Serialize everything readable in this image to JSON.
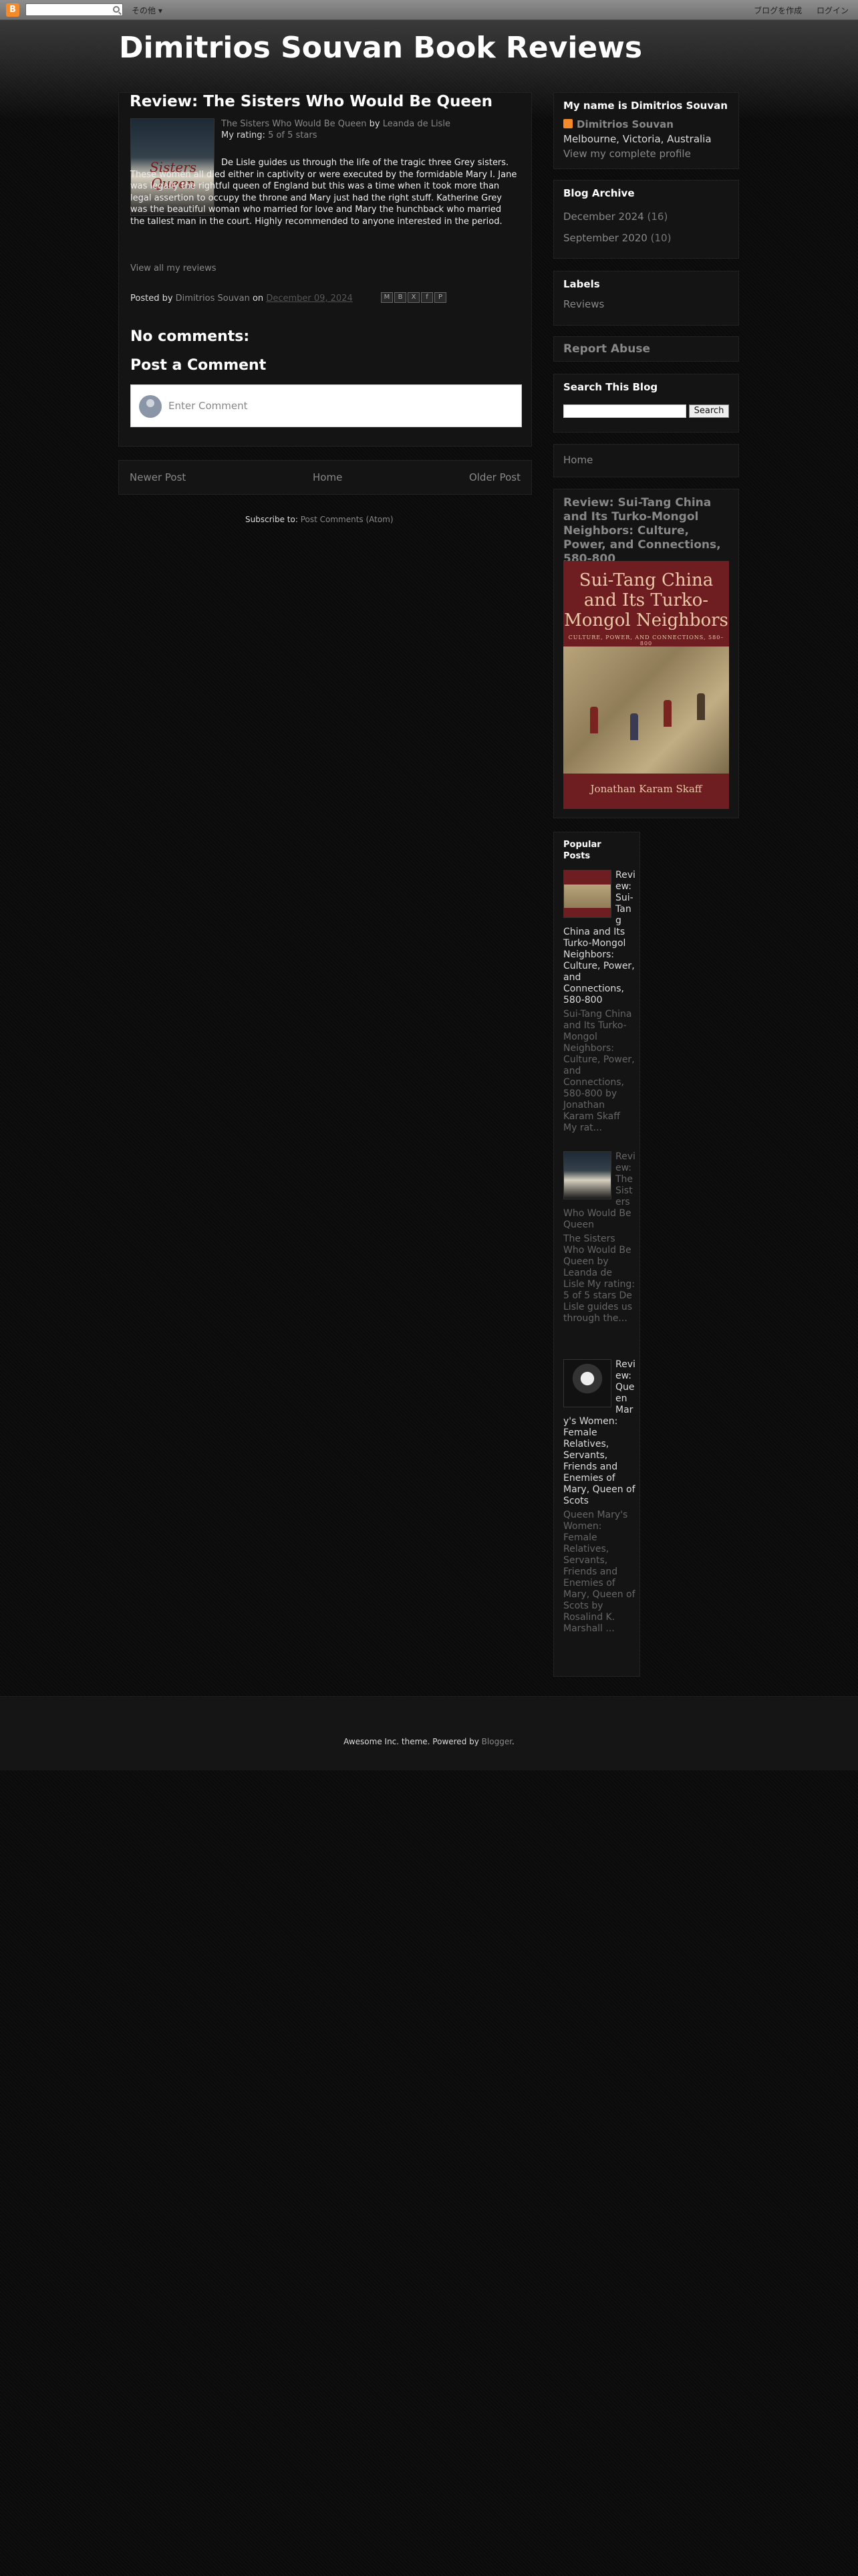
{
  "navbar": {
    "logo": "B",
    "more": "その他 ▾",
    "create_blog": "ブログを作成",
    "login": "ログイン"
  },
  "header": {
    "title": "Dimitrios Souvan Book Reviews"
  },
  "post": {
    "title": "Review: The Sisters Who Would Be Queen",
    "cover_title": "Sisters Queen",
    "book_link": "The Sisters Who Would Be Queen",
    "by": "by",
    "author_link": "Leanda de Lisle",
    "rating_label": "My rating:",
    "rating_value": "5 of 5 stars",
    "body": "De Lisle guides us through the life of the tragic three Grey sisters. These women all died either in captivity or were executed by the formidable Mary I. Jane was legally the rightful queen of England but this was a time when it took more than legal assertion to occupy the throne and Mary just had the right stuff. Katherine Grey was the beautiful woman who married for love and Mary the hunchback who married the tallest man in the court. Highly recommended to anyone interested in the period.",
    "view_all": "View all my reviews",
    "posted_by_label": "Posted by",
    "posted_by_author": "Dimitrios Souvan",
    "on": "on",
    "date": "December 09, 2024",
    "share_icons": [
      "mail-icon",
      "blog-icon",
      "x-icon",
      "facebook-icon",
      "pinterest-icon"
    ],
    "share_glyphs": [
      "M",
      "B",
      "X",
      "f",
      "P"
    ]
  },
  "comments": {
    "heading": "No comments:",
    "post_heading": "Post a Comment",
    "placeholder": "Enter Comment"
  },
  "pager": {
    "newer": "Newer Post",
    "home": "Home",
    "older": "Older Post"
  },
  "subscribe": {
    "label": "Subscribe to:",
    "link": "Post Comments (Atom)"
  },
  "sidebar": {
    "profile": {
      "heading": "My name is Dimitrios Souvan",
      "name": "Dimitrios Souvan",
      "location": "Melbourne, Victoria, Australia",
      "link": "View my complete profile"
    },
    "archive": {
      "heading": "Blog Archive",
      "items": [
        {
          "label": "December 2024",
          "count": "(16)"
        },
        {
          "label": "September 2020",
          "count": "(10)"
        }
      ]
    },
    "labels": {
      "heading": "Labels",
      "items": [
        "Reviews"
      ]
    },
    "abuse": "Report Abuse",
    "search": {
      "heading": "Search This Blog",
      "button": "Search"
    },
    "home": "Home",
    "featured": {
      "title": "Review: Sui-Tang China and Its Turko-Mongol Neighbors: Culture, Power, and Connections, 580-800",
      "cover_title": "Sui-Tang China and Its Turko-Mongol Neighbors",
      "cover_subtitle": "CULTURE, POWER, AND CONNECTIONS, 580–800",
      "cover_author": "Jonathan Karam Skaff"
    },
    "popular": {
      "heading": "Popular Posts",
      "items": [
        {
          "title": "Review: Sui-Tang China and Its Turko-Mongol Neighbors: Culture, Power, and Connections, 580-800",
          "snippet": "Sui-Tang China and Its Turko-Mongol Neighbors: Culture, Power, and Connections, 580-800 by Jonathan Karam Skaff My rat..."
        },
        {
          "title": "Review: The Sisters Who Would Be Queen",
          "snippet": "The Sisters Who Would Be Queen by Leanda de Lisle My rating: 5 of 5 stars De Lisle guides us through the..."
        },
        {
          "title": "Review: Queen Mary's Women: Female Relatives, Servants, Friends and Enemies of Mary, Queen of Scots",
          "snippet": "Queen Mary's Women: Female Relatives, Servants, Friends and Enemies of Mary, Queen of Scots by Rosalind K. Marshall ..."
        }
      ]
    }
  },
  "footer": {
    "text": "Awesome Inc. theme. Powered by",
    "link": "Blogger",
    "end": "."
  }
}
